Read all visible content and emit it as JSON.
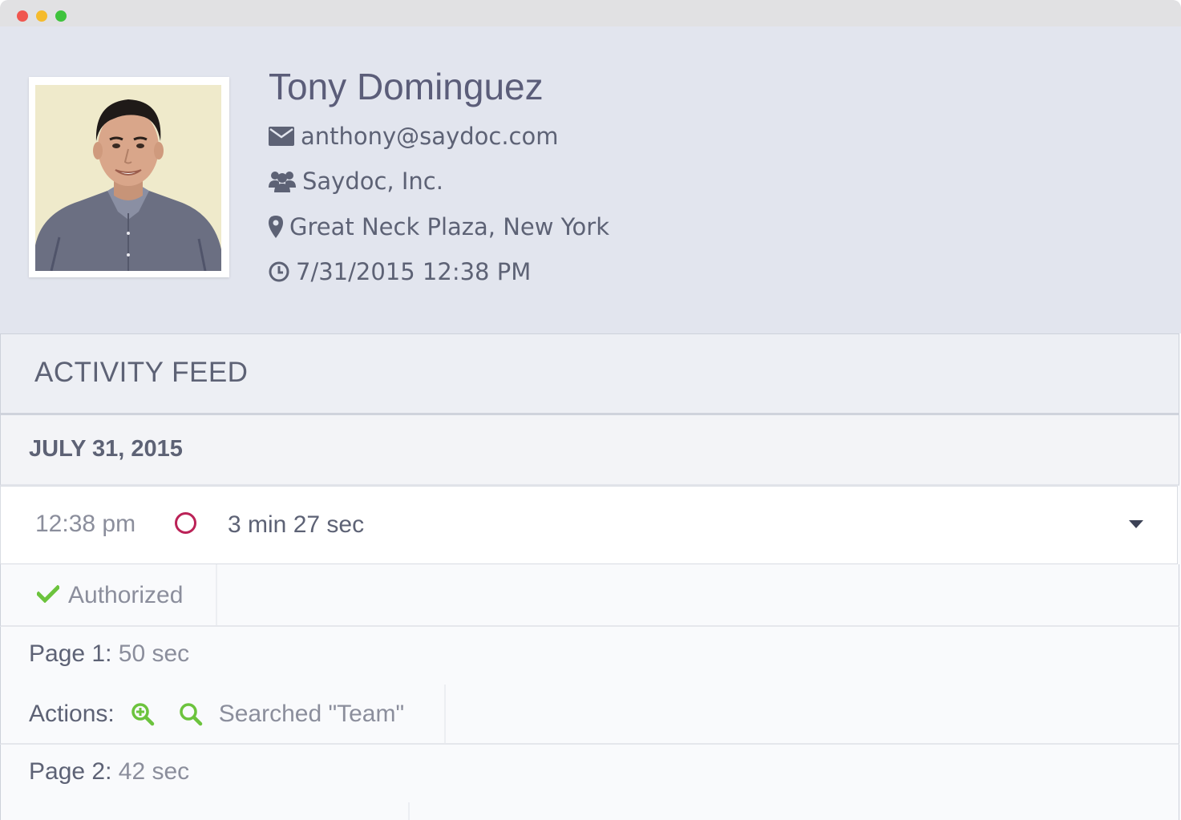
{
  "profile": {
    "name": "Tony Dominguez",
    "email": "anthony@saydoc.com",
    "company": "Saydoc, Inc.",
    "location": "Great Neck Plaza, New York",
    "last_seen": "7/31/2015 12:38 PM"
  },
  "feed": {
    "title": "ACTIVITY FEED",
    "date": "JULY 31, 2015",
    "session": {
      "time": "12:38 pm",
      "duration": "3 min 27 sec"
    },
    "status": "Authorized",
    "pages": [
      {
        "label": "Page 1:",
        "value": "50 sec",
        "actions_label": "Actions:",
        "search_text": "Searched \"Team\""
      },
      {
        "label": "Page 2:",
        "value": "42 sec"
      }
    ]
  },
  "colors": {
    "profile_bg": "#e2e5ee",
    "accent_green": "#6cc33d",
    "session_circle": "#bb2257",
    "text_primary": "#5d6275",
    "text_muted": "#8b8e9c"
  },
  "icons": [
    "envelope-icon",
    "users-icon",
    "map-marker-icon",
    "clock-icon",
    "check-icon",
    "zoom-in-icon",
    "search-icon",
    "caret-down-icon"
  ]
}
